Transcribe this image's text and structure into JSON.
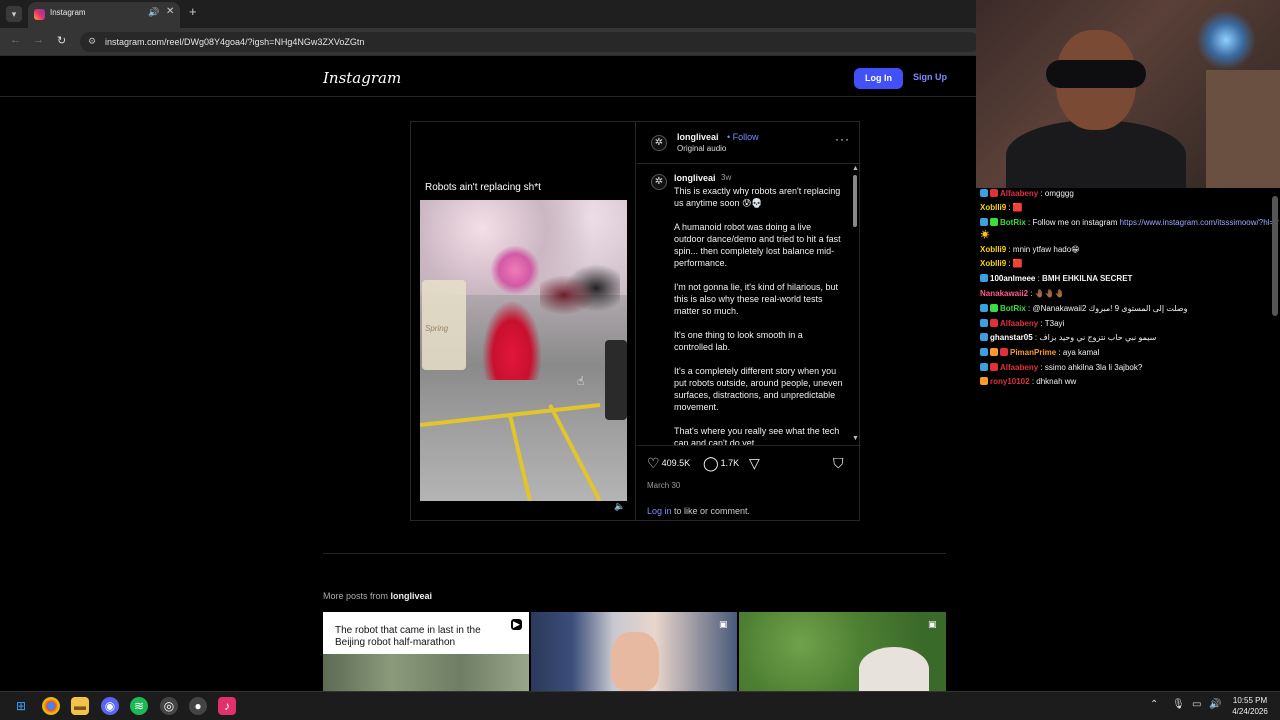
{
  "browser": {
    "tab_title": "Instagram",
    "url": "instagram.com/reel/DWg08Y4goa4/?igsh=NHg4NGw3ZXVoZGtn",
    "icons": {
      "back": "arrow-left-icon",
      "forward": "arrow-right-icon",
      "reload": "reload-icon",
      "site_info": "tune-icon",
      "audio": "speaker-icon",
      "close": "close-icon",
      "new_tab": "plus-icon"
    }
  },
  "header": {
    "logo": "Instagram",
    "login_label": "Log In",
    "signup_label": "Sign Up",
    "accent_color": "#4150f7"
  },
  "post": {
    "video_caption": "Robots ain't replacing sh*t",
    "sign_text": "Spring",
    "username": "longliveai",
    "follow_separator": "•",
    "follow_label": "Follow",
    "audio_label": "Original audio",
    "comment_time": "3w",
    "caption_paragraphs": [
      "This is exactly why robots aren't replacing us anytime soon 😰💀",
      "A humanoid robot was doing a live outdoor dance/demo and tried to hit a fast spin... then completely lost balance mid-performance.",
      "I'm not gonna lie, it's kind of hilarious, but this is also why these real-world tests matter so much.",
      "It's one thing to look smooth in a controlled lab.",
      "It's a completely different story when you put robots outside, around people, uneven surfaces, distractions, and unpredictable movement.",
      "That's where you really see what the tech can and can't do yet."
    ],
    "likes": "409.5K",
    "comments": "1.7K",
    "date": "March 30",
    "login_link": "Log in",
    "login_suffix": " to like or comment."
  },
  "more_posts": {
    "prefix": "More posts from ",
    "username": "longliveai",
    "thumb1_text": "The robot that came in last in the Beijing robot half-marathon"
  },
  "chat": [
    {
      "user": "Alfaabeny",
      "msg": "omgggg",
      "color": "#e0303a"
    },
    {
      "user": "Xoblli9",
      "msg": "🟥",
      "color": "#ffd400"
    },
    {
      "user": "BotRix",
      "msg": "Follow me on instagram ",
      "link": "https://www.instagram.com/itsssimoow/?hl=fr",
      "tail": " ☀️",
      "color": "#3ddc3d"
    },
    {
      "user": "Xoblli9",
      "msg": "mnin ytfaw hado😁",
      "color": "#ffd400"
    },
    {
      "user": "Xoblli9",
      "msg": "🟥",
      "color": "#ffd400"
    },
    {
      "user": "100anlmeee",
      "msg": "BMH EHKILNA SECRET",
      "color": "#ffffff"
    },
    {
      "user": "Nanakawaii2",
      "msg": "🤚🏾🤚🏾🤚🏾",
      "color": "#ff5a8a"
    },
    {
      "user": "BotRix",
      "msg": "@Nanakawaii2 وصلت إلى المستوى 9 !مبروك",
      "color": "#3ddc3d"
    },
    {
      "user": "Alfaabeny",
      "msg": "T3ayi",
      "color": "#e0303a"
    },
    {
      "user": "ghanstar05",
      "msg": "سيمو نبي حاب نتزوج ني وحيد بزاف",
      "color": "#ffffff"
    },
    {
      "user": "PimanPrime",
      "msg": "aya kamal",
      "color": "#ff9a2a"
    },
    {
      "user": "Alfaabeny",
      "msg": "ssimo ahkilna 3la li 3ajbok?",
      "color": "#e0303a"
    },
    {
      "user": "rony10102",
      "msg": "dhknah ww",
      "color": "#e0303a"
    }
  ],
  "taskbar": {
    "time": "10:55 PM",
    "date": "4/24/2026"
  }
}
